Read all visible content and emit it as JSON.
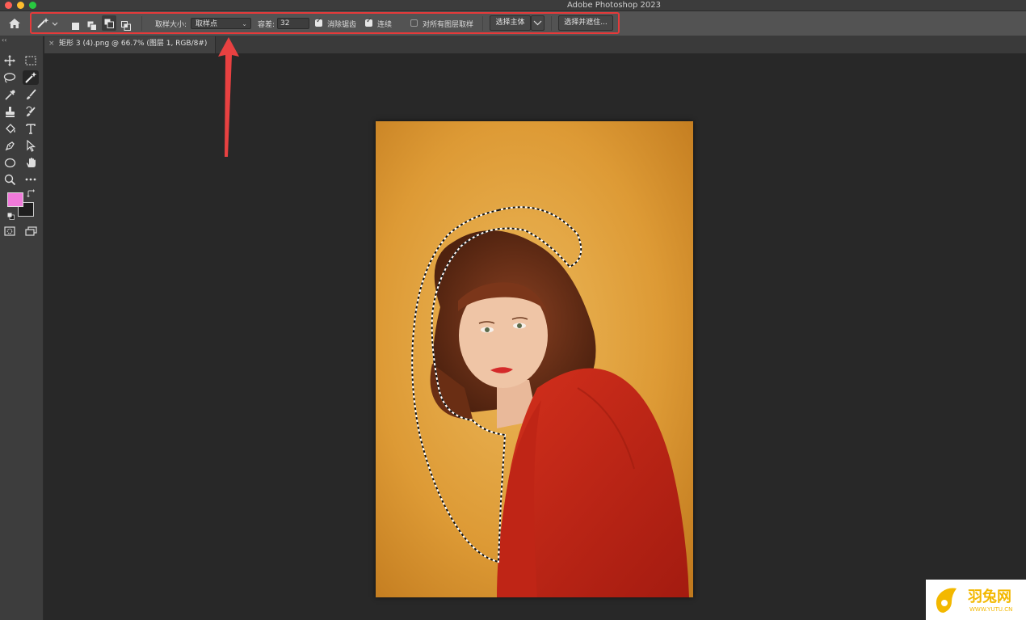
{
  "app": {
    "title": "Adobe Photoshop 2023"
  },
  "options": {
    "sample_size_label": "取样大小:",
    "sample_size_value": "取样点",
    "tolerance_label": "容差:",
    "tolerance_value": "32",
    "anti_alias_label": "消除锯齿",
    "anti_alias_checked": true,
    "contiguous_label": "连续",
    "contiguous_checked": true,
    "sample_all_layers_label": "对所有图层取样",
    "sample_all_layers_checked": false,
    "select_subject_label": "选择主体",
    "select_and_mask_label": "选择并遮住..."
  },
  "document": {
    "tab_label": "矩形 3 (4).png @ 66.7% (图层 1, RGB/8#)",
    "close_glyph": "×"
  },
  "toolbar": {
    "collapse_glyph": "‹‹",
    "colors": {
      "foreground": "#f07ada",
      "background": "#1e1e1e"
    }
  },
  "watermark": {
    "brand": "羽兔网",
    "url": "WWW.YUTU.CN"
  },
  "colors": {
    "highlight": "#e53a3a",
    "panel": "#535353",
    "workspace": "#282828"
  }
}
